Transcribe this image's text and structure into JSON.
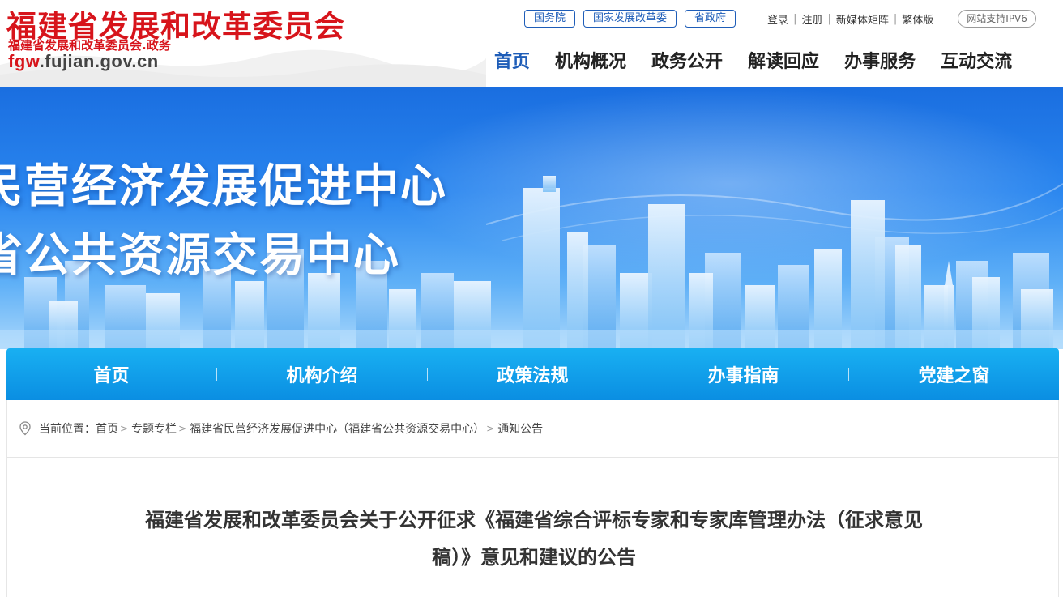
{
  "header": {
    "title": "福建省发展和改革委员会",
    "subtitle": "福建省发展和改革委员会.政务",
    "domain_prefix": "fgw",
    "domain_rest": ".fujian.gov.cn",
    "pills": [
      "国务院",
      "国家发展改革委",
      "省政府"
    ],
    "util_links": [
      "登录",
      "注册",
      "新媒体矩阵",
      "繁体版"
    ],
    "ipv6_badge": "网站支持IPV6",
    "nav": [
      "首页",
      "机构概况",
      "政务公开",
      "解读回应",
      "办事服务",
      "互动交流"
    ]
  },
  "banner": {
    "line1": "民营经济发展促进中心",
    "line2": "省公共资源交易中心"
  },
  "sub_nav": [
    "首页",
    "机构介绍",
    "政策法规",
    "办事指南",
    "党建之窗"
  ],
  "breadcrumb": {
    "label": "当前位置：",
    "items": [
      "首页",
      "专题专栏",
      "福建省民营经济发展促进中心（福建省公共资源交易中心）",
      "通知公告"
    ]
  },
  "article": {
    "title_line1": "福建省发展和改革委员会关于公开征求《福建省综合评标专家和专家库管理办法（征求意见",
    "title_line2": "稿）》意见和建议的公告"
  },
  "colors": {
    "brand_red": "#d7141b",
    "brand_blue": "#1e5db8",
    "subnav_blue": "#0a8ee2"
  }
}
